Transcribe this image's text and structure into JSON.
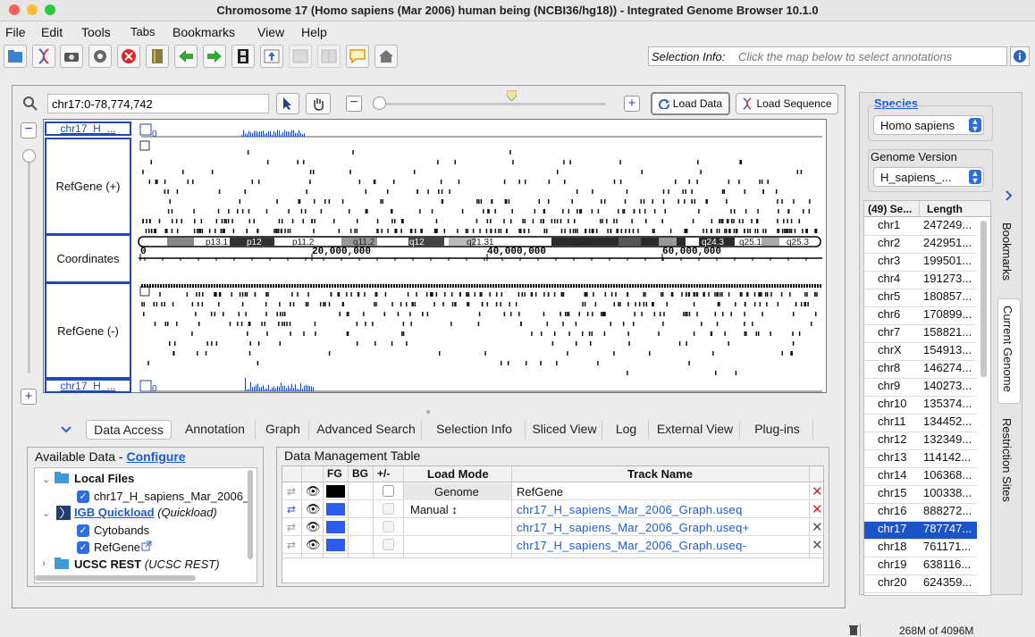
{
  "window": {
    "title": "Chromosome 17  (Homo sapiens (Mar 2006) human being (NCBI36/hg18)) - Integrated Genome Browser 10.1.0"
  },
  "menu": [
    "File",
    "Edit",
    "Tools",
    "Tabs",
    "Bookmarks",
    "View",
    "Help"
  ],
  "selection_info": {
    "label": "Selection Info:",
    "placeholder": "Click the map below to select annotations"
  },
  "nav": {
    "location": "chr17:0-78,774,742",
    "load_data": "Load Data",
    "load_sequence": "Load Sequence"
  },
  "tracks": {
    "graph_top": "chr17_H_...",
    "graph_bottom": "chr17_H_...",
    "refgene_plus": "RefGene (+)",
    "coordinates": "Coordinates",
    "refgene_minus": "RefGene (-)",
    "zero": "0",
    "ticks": [
      "0",
      "20,000,000",
      "40,000,000",
      "60,000,000"
    ],
    "bands": [
      "p13.1",
      "p12",
      "p11.2",
      "q11.2",
      "q12",
      "q21.31",
      "q22",
      "q24.3",
      "q25.1",
      "q25.3"
    ]
  },
  "bottom_tabs": [
    "Data Access",
    "Annotation",
    "Graph",
    "Advanced Search",
    "Selection Info",
    "Sliced View",
    "Log",
    "External View",
    "Plug-ins"
  ],
  "available_data": {
    "title": "Available Data -",
    "configure": "Configure",
    "local_files": "Local Files",
    "local_file_item": "chr17_H_sapiens_Mar_2006_(",
    "quickload": "IGB Quickload",
    "quickload_suffix": "(Quickload)",
    "cytobands": "Cytobands",
    "refgene": "RefGene",
    "ucsc": "UCSC REST",
    "ucsc_suffix": "(UCSC REST)"
  },
  "dmt": {
    "title": "Data Management Table",
    "headers": {
      "fg": "FG",
      "bg": "BG",
      "pm": "+/-",
      "load_mode": "Load Mode",
      "track_name": "Track Name"
    },
    "rows": [
      {
        "load_mode": "Genome",
        "track": "RefGene",
        "fg": "#000000"
      },
      {
        "load_mode": "Manual ↕",
        "track": "chr17_H_sapiens_Mar_2006_Graph.useq",
        "fg": "#2c5cf0"
      },
      {
        "load_mode": "",
        "track": "chr17_H_sapiens_Mar_2006_Graph.useq+",
        "fg": "#2c5cf0"
      },
      {
        "load_mode": "",
        "track": "chr17_H_sapiens_Mar_2006_Graph.useq-",
        "fg": "#2c5cf0"
      }
    ]
  },
  "right": {
    "species_label": "Species",
    "species_value": "Homo sapiens",
    "genome_label": "Genome Version",
    "genome_value": "H_sapiens_...",
    "col_seq": "(49) Se...",
    "col_len": "Length",
    "chroms": [
      [
        "chr1",
        "247249..."
      ],
      [
        "chr2",
        "242951..."
      ],
      [
        "chr3",
        "199501..."
      ],
      [
        "chr4",
        "191273..."
      ],
      [
        "chr5",
        "180857..."
      ],
      [
        "chr6",
        "170899..."
      ],
      [
        "chr7",
        "158821..."
      ],
      [
        "chrX",
        "154913..."
      ],
      [
        "chr8",
        "146274..."
      ],
      [
        "chr9",
        "140273..."
      ],
      [
        "chr10",
        "135374..."
      ],
      [
        "chr11",
        "134452..."
      ],
      [
        "chr12",
        "132349..."
      ],
      [
        "chr13",
        "114142..."
      ],
      [
        "chr14",
        "106368..."
      ],
      [
        "chr15",
        "100338..."
      ],
      [
        "chr16",
        "888272..."
      ],
      [
        "chr17",
        "787747..."
      ],
      [
        "chr18",
        "761171..."
      ],
      [
        "chr19",
        "638116..."
      ],
      [
        "chr20",
        "624359..."
      ]
    ],
    "selected": "chr17",
    "side_tabs": [
      "Bookmarks",
      "Current Genome",
      "Restriction Sites"
    ]
  },
  "memory": "268M of 4096M",
  "colors": {
    "accent": "#2149b3",
    "selected_row": "#1d53c9",
    "close_red": "#d9262b"
  }
}
